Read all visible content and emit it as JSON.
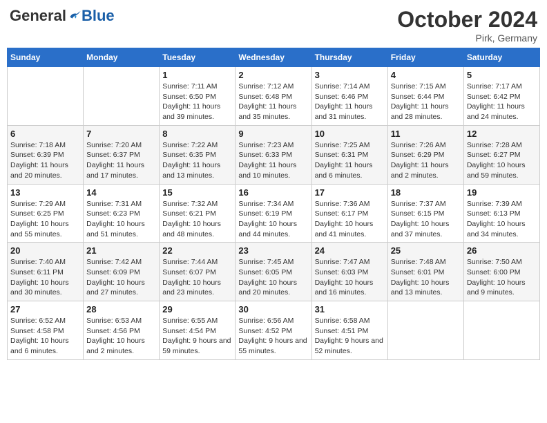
{
  "logo": {
    "general": "General",
    "blue": "Blue"
  },
  "title": "October 2024",
  "location": "Pirk, Germany",
  "days_of_week": [
    "Sunday",
    "Monday",
    "Tuesday",
    "Wednesday",
    "Thursday",
    "Friday",
    "Saturday"
  ],
  "weeks": [
    [
      {
        "day": "",
        "info": ""
      },
      {
        "day": "",
        "info": ""
      },
      {
        "day": "1",
        "info": "Sunrise: 7:11 AM\nSunset: 6:50 PM\nDaylight: 11 hours and 39 minutes."
      },
      {
        "day": "2",
        "info": "Sunrise: 7:12 AM\nSunset: 6:48 PM\nDaylight: 11 hours and 35 minutes."
      },
      {
        "day": "3",
        "info": "Sunrise: 7:14 AM\nSunset: 6:46 PM\nDaylight: 11 hours and 31 minutes."
      },
      {
        "day": "4",
        "info": "Sunrise: 7:15 AM\nSunset: 6:44 PM\nDaylight: 11 hours and 28 minutes."
      },
      {
        "day": "5",
        "info": "Sunrise: 7:17 AM\nSunset: 6:42 PM\nDaylight: 11 hours and 24 minutes."
      }
    ],
    [
      {
        "day": "6",
        "info": "Sunrise: 7:18 AM\nSunset: 6:39 PM\nDaylight: 11 hours and 20 minutes."
      },
      {
        "day": "7",
        "info": "Sunrise: 7:20 AM\nSunset: 6:37 PM\nDaylight: 11 hours and 17 minutes."
      },
      {
        "day": "8",
        "info": "Sunrise: 7:22 AM\nSunset: 6:35 PM\nDaylight: 11 hours and 13 minutes."
      },
      {
        "day": "9",
        "info": "Sunrise: 7:23 AM\nSunset: 6:33 PM\nDaylight: 11 hours and 10 minutes."
      },
      {
        "day": "10",
        "info": "Sunrise: 7:25 AM\nSunset: 6:31 PM\nDaylight: 11 hours and 6 minutes."
      },
      {
        "day": "11",
        "info": "Sunrise: 7:26 AM\nSunset: 6:29 PM\nDaylight: 11 hours and 2 minutes."
      },
      {
        "day": "12",
        "info": "Sunrise: 7:28 AM\nSunset: 6:27 PM\nDaylight: 10 hours and 59 minutes."
      }
    ],
    [
      {
        "day": "13",
        "info": "Sunrise: 7:29 AM\nSunset: 6:25 PM\nDaylight: 10 hours and 55 minutes."
      },
      {
        "day": "14",
        "info": "Sunrise: 7:31 AM\nSunset: 6:23 PM\nDaylight: 10 hours and 51 minutes."
      },
      {
        "day": "15",
        "info": "Sunrise: 7:32 AM\nSunset: 6:21 PM\nDaylight: 10 hours and 48 minutes."
      },
      {
        "day": "16",
        "info": "Sunrise: 7:34 AM\nSunset: 6:19 PM\nDaylight: 10 hours and 44 minutes."
      },
      {
        "day": "17",
        "info": "Sunrise: 7:36 AM\nSunset: 6:17 PM\nDaylight: 10 hours and 41 minutes."
      },
      {
        "day": "18",
        "info": "Sunrise: 7:37 AM\nSunset: 6:15 PM\nDaylight: 10 hours and 37 minutes."
      },
      {
        "day": "19",
        "info": "Sunrise: 7:39 AM\nSunset: 6:13 PM\nDaylight: 10 hours and 34 minutes."
      }
    ],
    [
      {
        "day": "20",
        "info": "Sunrise: 7:40 AM\nSunset: 6:11 PM\nDaylight: 10 hours and 30 minutes."
      },
      {
        "day": "21",
        "info": "Sunrise: 7:42 AM\nSunset: 6:09 PM\nDaylight: 10 hours and 27 minutes."
      },
      {
        "day": "22",
        "info": "Sunrise: 7:44 AM\nSunset: 6:07 PM\nDaylight: 10 hours and 23 minutes."
      },
      {
        "day": "23",
        "info": "Sunrise: 7:45 AM\nSunset: 6:05 PM\nDaylight: 10 hours and 20 minutes."
      },
      {
        "day": "24",
        "info": "Sunrise: 7:47 AM\nSunset: 6:03 PM\nDaylight: 10 hours and 16 minutes."
      },
      {
        "day": "25",
        "info": "Sunrise: 7:48 AM\nSunset: 6:01 PM\nDaylight: 10 hours and 13 minutes."
      },
      {
        "day": "26",
        "info": "Sunrise: 7:50 AM\nSunset: 6:00 PM\nDaylight: 10 hours and 9 minutes."
      }
    ],
    [
      {
        "day": "27",
        "info": "Sunrise: 6:52 AM\nSunset: 4:58 PM\nDaylight: 10 hours and 6 minutes."
      },
      {
        "day": "28",
        "info": "Sunrise: 6:53 AM\nSunset: 4:56 PM\nDaylight: 10 hours and 2 minutes."
      },
      {
        "day": "29",
        "info": "Sunrise: 6:55 AM\nSunset: 4:54 PM\nDaylight: 9 hours and 59 minutes."
      },
      {
        "day": "30",
        "info": "Sunrise: 6:56 AM\nSunset: 4:52 PM\nDaylight: 9 hours and 55 minutes."
      },
      {
        "day": "31",
        "info": "Sunrise: 6:58 AM\nSunset: 4:51 PM\nDaylight: 9 hours and 52 minutes."
      },
      {
        "day": "",
        "info": ""
      },
      {
        "day": "",
        "info": ""
      }
    ]
  ]
}
